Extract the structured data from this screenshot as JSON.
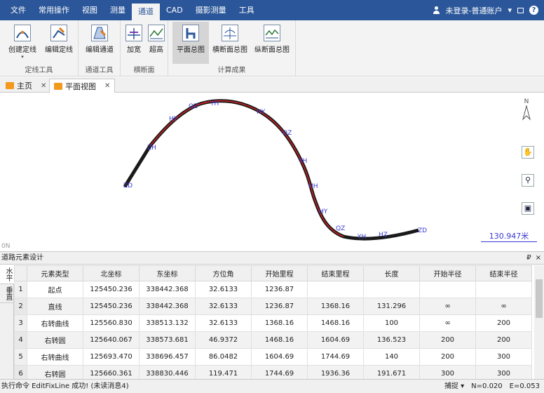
{
  "menu": {
    "items": [
      "文件",
      "常用操作",
      "视图",
      "测量",
      "通道",
      "CAD",
      "摄影测量",
      "工具"
    ],
    "active_index": 4,
    "user": "未登录-普通账户",
    "user_arrow": "▾",
    "help": "?"
  },
  "ribbon": {
    "groups": [
      {
        "label": "定线工具",
        "buttons": [
          "创建定线",
          "编辑定线"
        ]
      },
      {
        "label": "通道工具",
        "buttons": [
          "编辑通道"
        ]
      },
      {
        "label": "横断面",
        "buttons": [
          "加宽",
          "超高"
        ]
      },
      {
        "label": "计算成果",
        "buttons": [
          "平面总图",
          "横断面总图",
          "纵断面总图"
        ]
      }
    ],
    "selected_button": "平面总图"
  },
  "doctabs": [
    {
      "label": "主页",
      "active": false
    },
    {
      "label": "平面视图",
      "active": true
    }
  ],
  "canvas": {
    "point_labels": [
      "ZD",
      "ZH",
      "HY",
      "QZ",
      "YH",
      "HY",
      "QZ",
      "YH",
      "HH",
      "HY",
      "QZ",
      "YH",
      "HZ",
      "ZD"
    ],
    "scale": "130.947米",
    "compass": "N",
    "corner": "0N",
    "colors": {
      "route": "#1a1a1a",
      "curve": "#e02020",
      "label": "#3a3ad0"
    }
  },
  "panel": {
    "title": "道路元素设计",
    "pin": "₽",
    "close": "×",
    "vtabs": [
      "水平",
      "垂直"
    ],
    "columns": [
      "元素类型",
      "北坐标",
      "东坐标",
      "方位角",
      "开始里程",
      "结束里程",
      "长度",
      "开始半径",
      "结束半径"
    ],
    "rows": [
      {
        "n": "1",
        "cells": [
          "起点",
          "125450.236",
          "338442.368",
          "32.6133",
          "1236.87",
          "",
          "",
          "",
          ""
        ]
      },
      {
        "n": "2",
        "cells": [
          "直线",
          "125450.236",
          "338442.368",
          "32.6133",
          "1236.87",
          "1368.16",
          "131.296",
          "∞",
          "∞"
        ]
      },
      {
        "n": "3",
        "cells": [
          "右转曲线",
          "125560.830",
          "338513.132",
          "32.6133",
          "1368.16",
          "1468.16",
          "100",
          "∞",
          "200"
        ]
      },
      {
        "n": "4",
        "cells": [
          "右转圆",
          "125640.067",
          "338573.681",
          "46.9372",
          "1468.16",
          "1604.69",
          "136.523",
          "200",
          "200"
        ]
      },
      {
        "n": "5",
        "cells": [
          "右转曲线",
          "125693.470",
          "338696.457",
          "86.0482",
          "1604.69",
          "1744.69",
          "140",
          "200",
          "300"
        ]
      },
      {
        "n": "6",
        "cells": [
          "右转圆",
          "125660.361",
          "338830.446",
          "119.471",
          "1744.69",
          "1936.36",
          "191.671",
          "300",
          "300"
        ]
      }
    ]
  },
  "status": {
    "message": "执行命令 EditFixLine 成功!  (未读消息4)",
    "snap": "捕捉",
    "snap_arrow": "▾",
    "n": "N=0.020",
    "e": "E=0.053"
  }
}
